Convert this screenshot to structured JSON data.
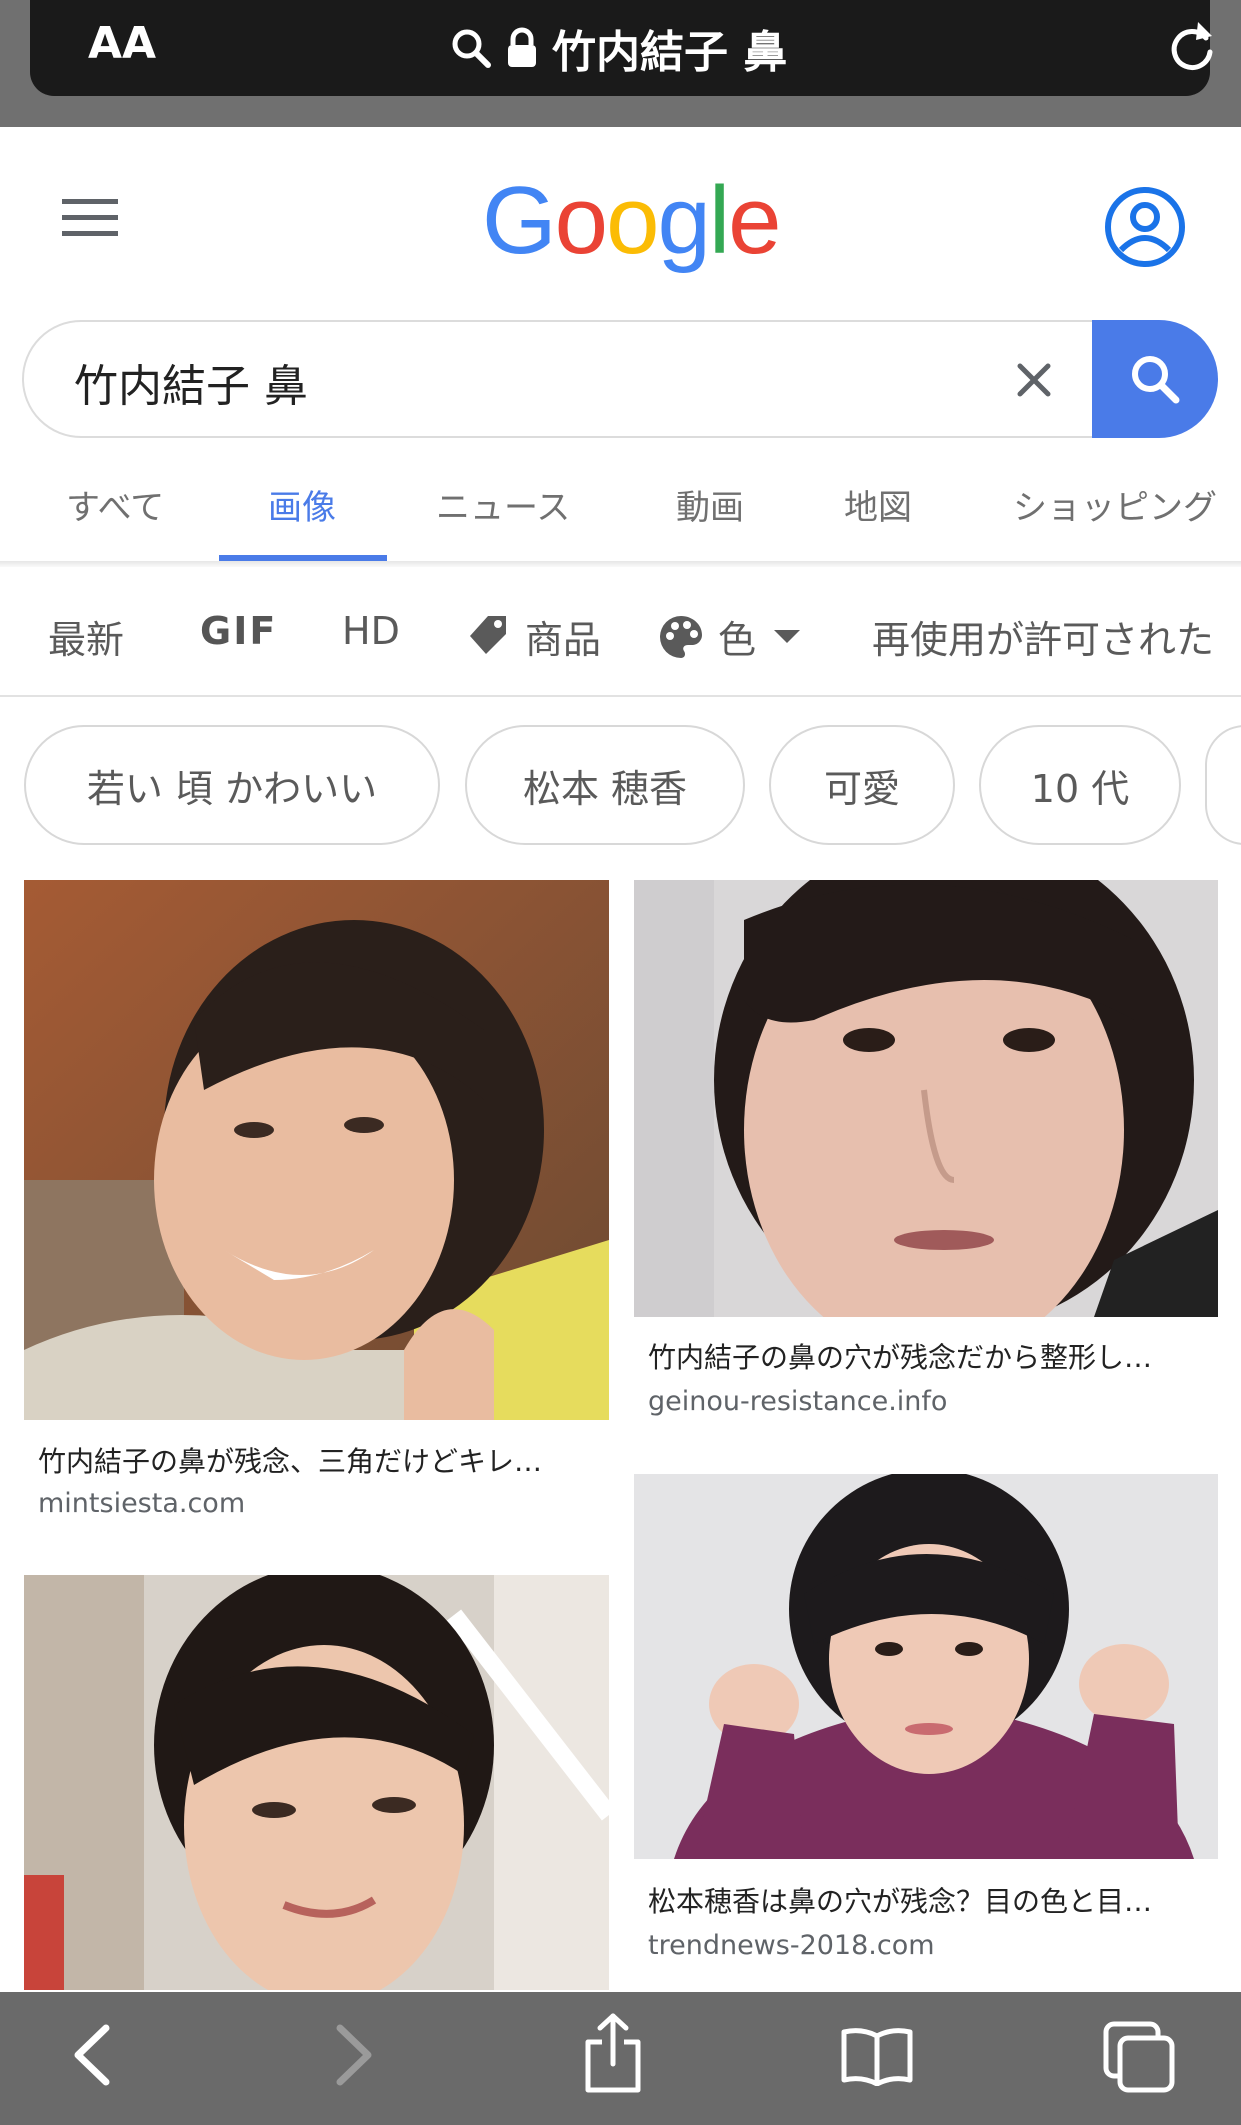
{
  "browser": {
    "text_size_label": "AA",
    "url_text": "竹内結子 鼻",
    "icons": [
      "search-icon",
      "lock-icon",
      "reload-icon"
    ]
  },
  "google": {
    "logo_letters": [
      {
        "ch": "G",
        "color": "#4285F4"
      },
      {
        "ch": "o",
        "color": "#EA4335"
      },
      {
        "ch": "o",
        "color": "#FBBC05"
      },
      {
        "ch": "g",
        "color": "#4285F4"
      },
      {
        "ch": "l",
        "color": "#34A853"
      },
      {
        "ch": "e",
        "color": "#EA4335"
      }
    ],
    "search": {
      "query": "竹内結子 鼻"
    },
    "tabs": [
      {
        "label": "すべて"
      },
      {
        "label": "画像",
        "active": true
      },
      {
        "label": "ニュース"
      },
      {
        "label": "動画"
      },
      {
        "label": "地図"
      },
      {
        "label": "ショッピング"
      }
    ],
    "filters": {
      "latest": "最新",
      "gif": "GIF",
      "hd": "HD",
      "products": "商品",
      "color": "色",
      "usage_rights": "再使用が許可された"
    },
    "chips": [
      "若い 頃 かわいい",
      "松本 穂香",
      "可愛",
      "10 代"
    ],
    "results": [
      {
        "caption": "竹内結子の鼻が残念、三角だけどキレ…",
        "domain": "mintsiesta.com"
      },
      {
        "caption": "竹内結子の鼻の穴が残念だから整形し…",
        "domain": "geinou-resistance.info"
      },
      {
        "caption": "松本穂香は鼻の穴が残念？目の色と目…",
        "domain": "trendnews-2018.com"
      }
    ]
  },
  "colors": {
    "accent": "#4a7be8",
    "toolbar": "#6a6a6a"
  },
  "toolbar_icons": [
    "back-icon",
    "forward-icon",
    "share-icon",
    "bookmarks-icon",
    "tabs-icon"
  ]
}
